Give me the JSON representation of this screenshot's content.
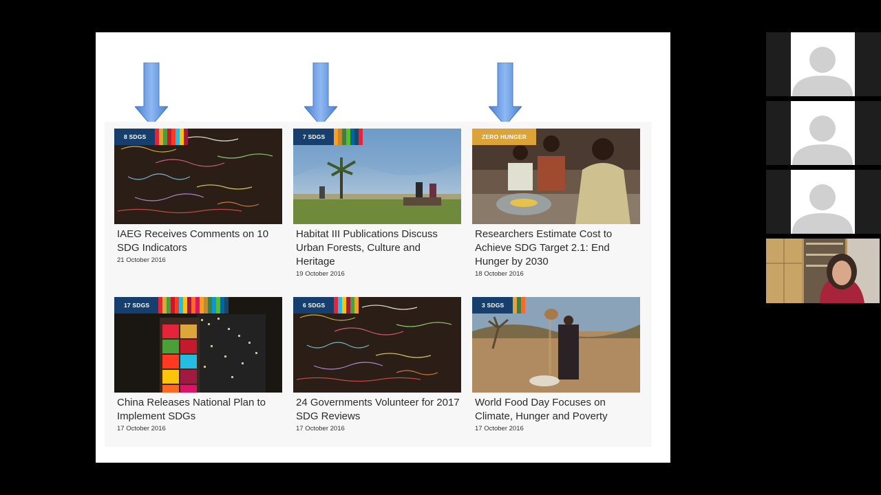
{
  "cards": [
    {
      "badge": "8 SDGS",
      "title": "IAEG Receives Comments on 10 SDG Indicators",
      "date": "21 October 2016",
      "bars": [
        "#e5243b",
        "#dda63a",
        "#4c9f38",
        "#c5192d",
        "#ff3a21",
        "#26bde2",
        "#fcc30b",
        "#a21942"
      ]
    },
    {
      "badge": "7 SDGS",
      "title": "Habitat III Publications Discuss Urban Forests, Culture and Heritage",
      "date": "19 October 2016",
      "bars": [
        "#fd9d24",
        "#bf8b2e",
        "#3f7e44",
        "#56c02b",
        "#00689d",
        "#19486a",
        "#e5243b"
      ]
    },
    {
      "badge": "ZERO HUNGER",
      "title": "Researchers Estimate Cost to Achieve SDG Target 2.1: End Hunger by 2030",
      "date": "18 October 2016",
      "bars": []
    },
    {
      "badge": "17 SDGS",
      "title": "China Releases National Plan to Implement SDGs",
      "date": "17 October 2016",
      "bars": [
        "#e5243b",
        "#dda63a",
        "#4c9f38",
        "#c5192d",
        "#ff3a21",
        "#26bde2",
        "#fcc30b",
        "#a21942",
        "#fd6925",
        "#dd1367",
        "#fd9d24",
        "#bf8b2e",
        "#3f7e44",
        "#0a97d9",
        "#56c02b",
        "#00689d",
        "#19486a"
      ]
    },
    {
      "badge": "6 SDGS",
      "title": "24 Governments Volunteer for 2017 SDG Reviews",
      "date": "17 October 2016",
      "bars": [
        "#e5243b",
        "#26bde2",
        "#fcc30b",
        "#a21942",
        "#4c9f38",
        "#fd9d24"
      ]
    },
    {
      "badge": "3 SDGS",
      "title": "World Food Day Focuses on Climate, Hunger and Poverty",
      "date": "17 October 2016",
      "bars": [
        "#dda63a",
        "#3f7e44",
        "#fd6925"
      ]
    }
  ],
  "colors": {
    "badge_blue": "#163f6e",
    "badge_gold": "#dca338",
    "arrow": "#5b8ed6"
  }
}
